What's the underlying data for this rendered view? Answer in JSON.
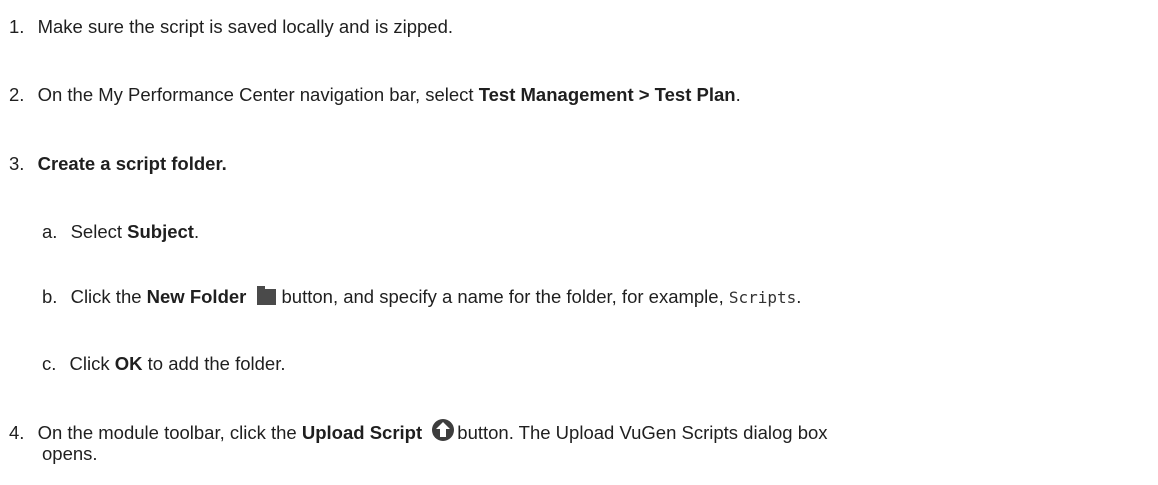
{
  "steps": [
    {
      "num": "1.",
      "text": "Make sure the script is saved locally and is zipped."
    },
    {
      "num": "2.",
      "pre": "On the My Performance Center navigation bar, select ",
      "bold": "Test Management > Test Plan",
      "post": "."
    },
    {
      "num": "3.",
      "bold": "Create a script folder.",
      "substeps": [
        {
          "num": "a.",
          "pre": "Select ",
          "bold": "Subject",
          "post": "."
        },
        {
          "num": "b.",
          "pre": "Click the ",
          "bold": "New Folder",
          "icon": "folder-icon",
          "post": "button, and specify a name for the folder, for example, ",
          "code": "Scripts",
          "end": "."
        },
        {
          "num": "c.",
          "pre": "Click ",
          "bold": "OK",
          "post": " to add the folder."
        }
      ]
    },
    {
      "num": "4.",
      "pre": "On the module toolbar, click the ",
      "bold": "Upload Script",
      "icon": "upload-arrow-icon",
      "post": "button. The Upload VuGen Scripts dialog box",
      "continuation": "opens."
    }
  ],
  "colors": {
    "text": "#1f1f1f",
    "folder_icon": "#4a4a4a",
    "upload_icon": "#3d3d3d"
  }
}
